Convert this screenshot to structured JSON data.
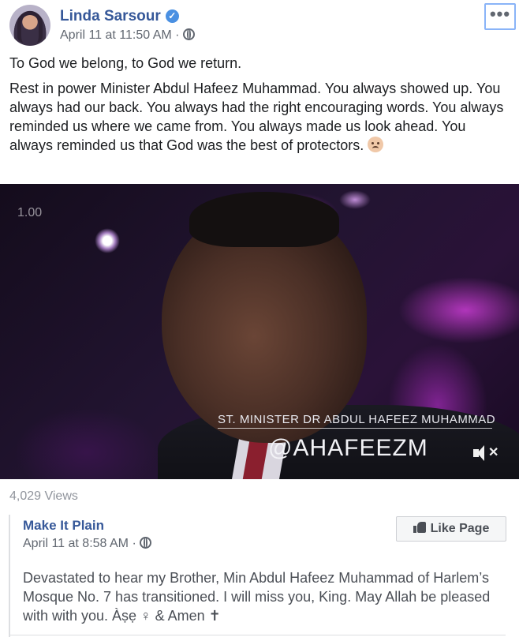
{
  "post": {
    "author": "Linda Sarsour",
    "timestamp": "April 11 at 11:50 AM",
    "separator": "·",
    "verified_icon": "verified-badge-icon",
    "privacy_icon": "globe-icon",
    "more_icon": "more-options-icon",
    "more_label": "•••",
    "paragraph1": "To God we belong, to God we return.",
    "paragraph2": "Rest in power Minister Abdul Hafeez Muhammad. You always showed up. You always had our back. You always had the right encouraging words. You always reminded us where we came from. You always made us look ahead. You always reminded us that God was the best of protectors.",
    "emoji_icon": "crying-face-emoji"
  },
  "video": {
    "timestamp_overlay": "1.00",
    "lower_third_name": "ST. MINISTER DR ABDUL HAFEEZ MUHAMMAD",
    "lower_third_handle": "@AHAFEEZM",
    "mute_icon": "muted-speaker-icon",
    "mute_x": "✕",
    "views": "4,029 Views"
  },
  "shared": {
    "page_name": "Make It Plain",
    "timestamp": "April 11 at 8:58 AM",
    "separator": "·",
    "privacy_icon": "globe-icon",
    "like_button_label": "Like Page",
    "like_icon": "thumbs-up-icon",
    "text": "Devastated to hear my Brother, Min Abdul Hafeez Muhammad of Harlem’s Mosque No. 7 has transitioned. I will miss you, King. May Allah be pleased with with you. Àṣẹ ♀ & Amen ✝"
  },
  "colors": {
    "link_blue": "#365899",
    "meta_gray": "#616770",
    "text_dark": "#1c1e21",
    "focus_outline": "#8ab4f8",
    "verified_blue": "#4a90e2"
  }
}
